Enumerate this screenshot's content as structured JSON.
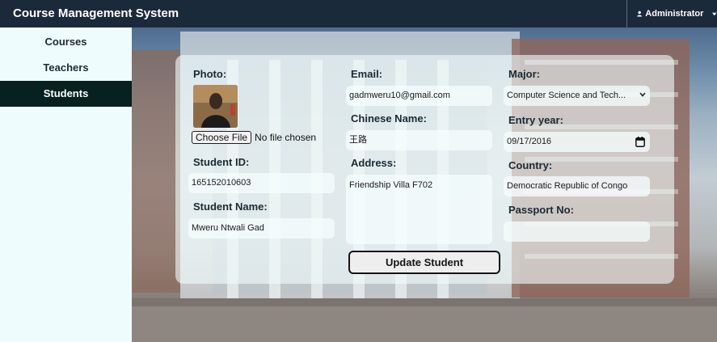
{
  "app": {
    "title": "Course Management System"
  },
  "user_menu": {
    "label": "Administrator",
    "icon": "user-icon",
    "caret_icon": "caret-down-icon"
  },
  "sidebar": {
    "items": [
      {
        "label": "Courses",
        "active": false
      },
      {
        "label": "Teachers",
        "active": false
      },
      {
        "label": "Students",
        "active": true
      }
    ]
  },
  "form": {
    "photo_label": "Photo:",
    "file_button": "Choose File",
    "file_status": "No file chosen",
    "student_id_label": "Student ID:",
    "student_id_value": "165152010603",
    "student_name_label": "Student Name:",
    "student_name_value": "Mweru Ntwali Gad",
    "email_label": "Email:",
    "email_value": "gadmweru10@gmail.com",
    "chinese_name_label": "Chinese Name:",
    "chinese_name_value": "王路",
    "address_label": "Address:",
    "address_value": "Friendship Villa F702",
    "major_label": "Major:",
    "major_value": "Computer Science and Tech...",
    "entry_year_label": "Entry year:",
    "entry_year_value": "09/17/2016",
    "country_label": "Country:",
    "country_value": "Democratic Republic of Congo",
    "passport_label": "Passport No:",
    "passport_value": "",
    "submit_label": "Update Student"
  },
  "icons": {
    "calendar": "calendar-icon",
    "select_chevron": "chevron-down-icon"
  },
  "colors": {
    "topbar": "#1b2a3a",
    "sidebar_active": "#06211f",
    "sidebar_bg": "#effcfd"
  }
}
